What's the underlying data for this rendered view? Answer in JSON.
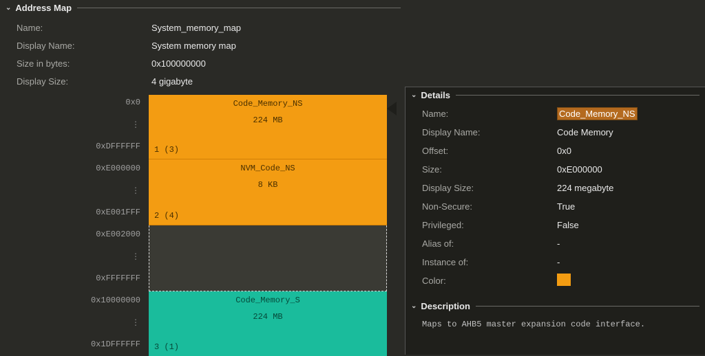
{
  "addressMap": {
    "title": "Address Map",
    "rows": {
      "nameKey": "Name:",
      "nameVal": "System_memory_map",
      "displayNameKey": "Display Name:",
      "displayNameVal": "System memory map",
      "sizeKey": "Size in bytes:",
      "sizeVal": "0x100000000",
      "dispSizeKey": "Display Size:",
      "dispSizeVal": "4 gigabyte"
    }
  },
  "addresses": {
    "a0": "0x0",
    "a1": "0xDFFFFFF",
    "a2": "0xE000000",
    "a3": "0xE001FFF",
    "a4": "0xE002000",
    "a5": "0xFFFFFFF",
    "a6": "0x10000000",
    "a7": "0x1DFFFFFF",
    "vdots": "⋮"
  },
  "blocks": {
    "b0": {
      "name": "Code_Memory_NS",
      "size": "224 MB",
      "idx": "1 (3)"
    },
    "b1": {
      "name": "NVM_Code_NS",
      "size": "8 KB",
      "idx": "2 (4)"
    },
    "b2": {
      "name": "Code_Memory_S",
      "size": "224 MB",
      "idx": "3 (1)"
    }
  },
  "details": {
    "title": "Details",
    "rows": {
      "nameKey": "Name:",
      "nameVal": "Code_Memory_NS",
      "dnKey": "Display Name:",
      "dnVal": "Code Memory",
      "offKey": "Offset:",
      "offVal": "0x0",
      "szKey": "Size:",
      "szVal": "0xE000000",
      "dszKey": "Display Size:",
      "dszVal": "224 megabyte",
      "nsKey": "Non-Secure:",
      "nsVal": "True",
      "prKey": "Privileged:",
      "prVal": "False",
      "alKey": "Alias of:",
      "alVal": "-",
      "inKey": "Instance of:",
      "inVal": "-",
      "colKey": "Color:"
    },
    "colorSwatch": "#f39c12"
  },
  "description": {
    "title": "Description",
    "text": "Maps to AHB5 master expansion code interface."
  }
}
